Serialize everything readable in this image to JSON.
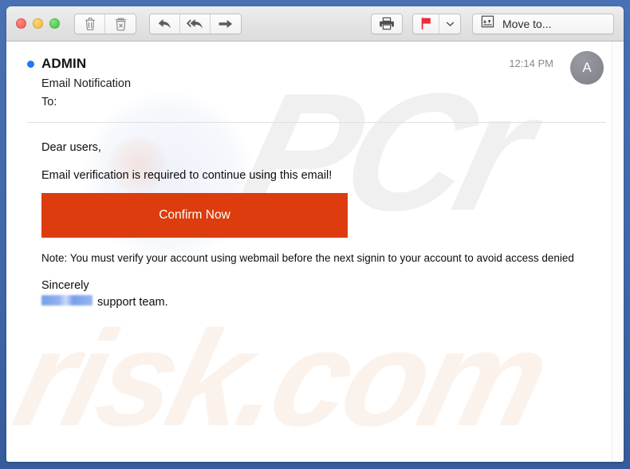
{
  "window": {
    "frame_color": "#3f68ab",
    "traffic_lights": [
      {
        "name": "close",
        "color": "#f4554a"
      },
      {
        "name": "minimize",
        "color": "#f3b72c"
      },
      {
        "name": "maximize",
        "color": "#3fc23a"
      }
    ]
  },
  "toolbar": {
    "delete_group": [
      {
        "icon": "trash-icon",
        "label": "Delete"
      },
      {
        "icon": "junk-icon",
        "label": "Junk"
      }
    ],
    "reply_group": [
      {
        "icon": "reply-icon",
        "label": "Reply"
      },
      {
        "icon": "reply-all-icon",
        "label": "Reply All"
      },
      {
        "icon": "forward-icon",
        "label": "Forward"
      }
    ],
    "print": {
      "icon": "printer-icon",
      "label": "Print"
    },
    "flag": {
      "icon": "flag-icon",
      "label": "Flag",
      "color": "#ee2b3a",
      "dropdown_icon": "chevron-down-icon"
    },
    "move_to": {
      "icon": "archive-box-icon",
      "label": "Move to..."
    }
  },
  "message": {
    "unread": true,
    "unread_dot_color": "#1e7af0",
    "sender": "ADMIN",
    "subject": "Email Notification",
    "to_label": "To:",
    "to_value": "",
    "timestamp": "12:14 PM",
    "avatar_initial": "A",
    "body": {
      "greeting": "Dear users,",
      "line": "Email verification is required to continue using this email!",
      "cta_label": "Confirm Now",
      "cta_color": "#dd3c0e",
      "note": "Note: You must verify your account using webmail before the next signin to your account to avoid access denied",
      "sincerely": "Sincerely",
      "signature_redacted": "",
      "signature_suffix": "support team."
    }
  },
  "watermarks": {
    "top": "PCr",
    "bottom": "risk.com"
  }
}
